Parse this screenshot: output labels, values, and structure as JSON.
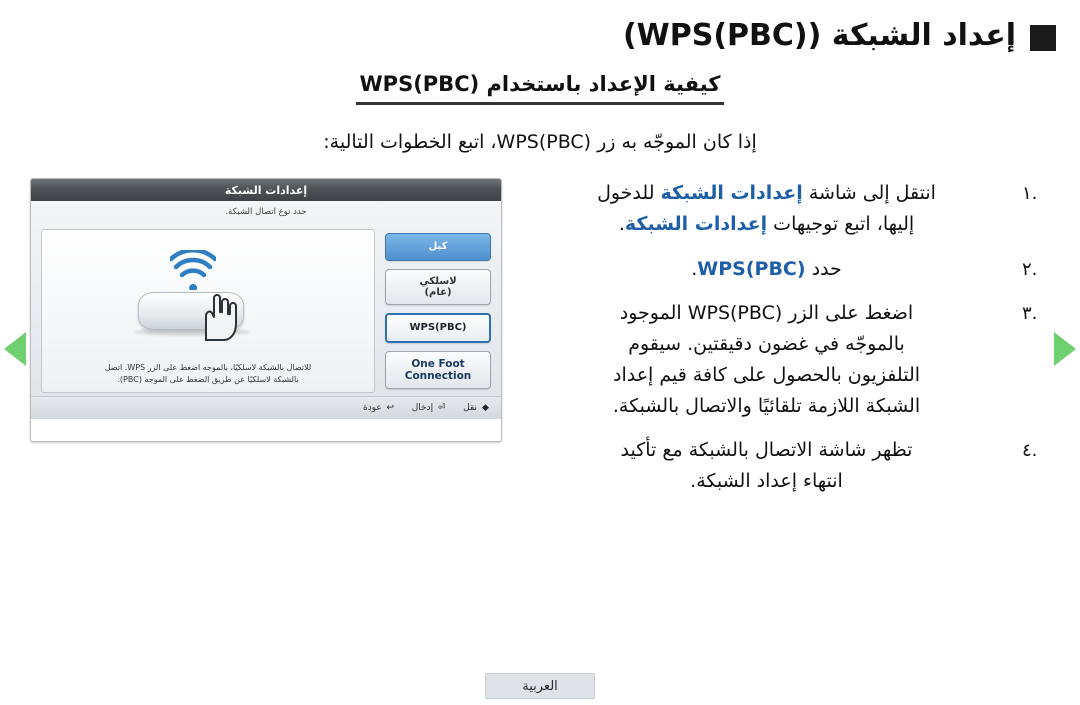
{
  "header": {
    "title": "إعداد الشبكة (WPS(PBC))",
    "bullet_icon": "square-bullet-icon"
  },
  "subtitle": "كيفية الإعداد باستخدام WPS(PBC)",
  "intro": "إذا كان الموجّه به زر WPS(PBC)، اتبع الخطوات التالية:",
  "steps": [
    {
      "num": ".١",
      "line1_pre": "انتقل إلى شاشة ",
      "line1_hl": "إعدادات الشبكة",
      "line1_post": " للدخول",
      "line2_pre": "إليها، اتبع توجيهات ",
      "line2_hl": "إعدادات الشبكة",
      "line2_post": "."
    },
    {
      "num": ".٢",
      "line1_pre": "حدد ",
      "line1_hl": "WPS(PBC)",
      "line1_post": "."
    },
    {
      "num": ".٣",
      "lines": [
        "اضغط على الزر WPS(PBC) الموجود",
        "بالموجّه في غضون دقيقتين. سيقوم",
        "التلفزيون بالحصول على كافة قيم إعداد",
        "الشبكة اللازمة تلقائيًا والاتصال بالشبكة."
      ]
    },
    {
      "num": ".٤",
      "lines": [
        "تظهر شاشة الاتصال بالشبكة مع تأكيد",
        "انتهاء إعداد الشبكة."
      ]
    }
  ],
  "tv_screen": {
    "titlebar": "إعدادات الشبكة",
    "hint": "حدد نوع اتصال الشبكة.",
    "menu_items": [
      {
        "label": "كبل",
        "style": "blue"
      },
      {
        "label": "لاسلكي\n(عام)",
        "style": "plain"
      },
      {
        "label": "WPS(PBC)",
        "style": "selected"
      },
      {
        "label": "One Foot\nConnection",
        "style": "plain"
      }
    ],
    "panel_text_line1": "للاتصال بالشبكة لاسلكيًا، بالموجه اضغط على الزر WPS. اتصل",
    "panel_text_line2": "بالشبكة لاسلكيًا عن طريق الضغط على الموجه (PBC).",
    "footer": [
      {
        "key": "◆",
        "label": "نقل"
      },
      {
        "key": "⏎",
        "label": "إدخال"
      },
      {
        "key": "↩",
        "label": "عودة"
      }
    ],
    "icons": [
      "wifi-icon",
      "hand-pointer-icon",
      "router-icon"
    ]
  },
  "footer": {
    "language_tab": "العربية"
  },
  "nav": {
    "prev_icon": "prev-page-arrow-icon",
    "next_icon": "next-page-arrow-icon",
    "accent_color": "#6fd06f"
  }
}
